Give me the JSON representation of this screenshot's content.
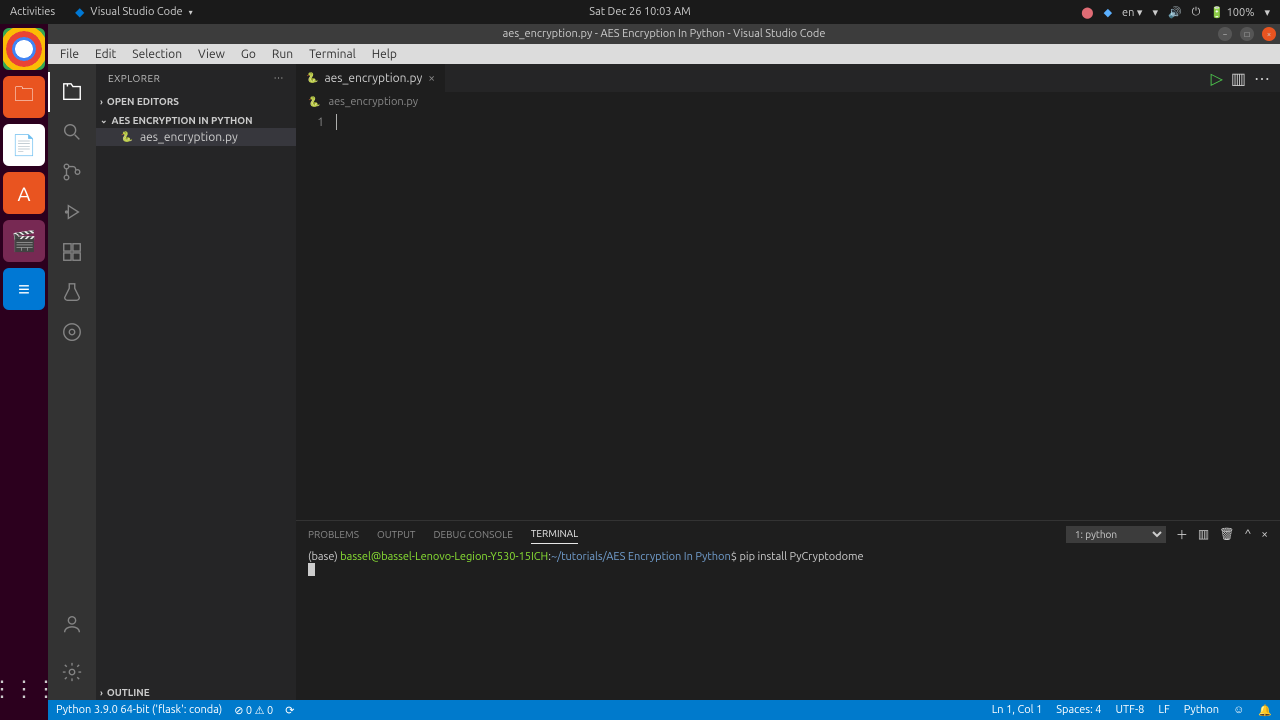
{
  "sys": {
    "activities": "Activities",
    "app_label": "Visual Studio Code",
    "datetime": "Sat Dec 26  10:03 AM",
    "lang": "en",
    "battery": "100%"
  },
  "titlebar": {
    "title": "aes_encryption.py - AES Encryption In Python - Visual Studio Code"
  },
  "menu": {
    "items": [
      "File",
      "Edit",
      "Selection",
      "View",
      "Go",
      "Run",
      "Terminal",
      "Help"
    ]
  },
  "sidebar": {
    "title": "EXPLORER",
    "open_editors": "OPEN EDITORS",
    "project": "AES ENCRYPTION IN PYTHON",
    "file": "aes_encryption.py",
    "outline": "OUTLINE"
  },
  "tabs": {
    "file": "aes_encryption.py"
  },
  "breadcrumb": {
    "file": "aes_encryption.py"
  },
  "editor": {
    "line1": "1"
  },
  "panel": {
    "tabs": {
      "problems": "PROBLEMS",
      "output": "OUTPUT",
      "debug": "DEBUG CONSOLE",
      "terminal": "TERMINAL"
    },
    "select": "1: python",
    "term_base": "(base) ",
    "term_userhost": "bassel@bassel-Lenovo-Legion-Y530-15ICH",
    "term_colon": ":",
    "term_path": "~/tutorials/AES Encryption In Python",
    "term_dollar": "$ ",
    "term_cmd": "pip install PyCryptodome"
  },
  "status": {
    "python": "Python 3.9.0 64-bit ('flask': conda)",
    "errors": "⊘ 0 ⚠ 0",
    "live": "⟳",
    "lncol": "Ln 1, Col 1",
    "spaces": "Spaces: 4",
    "encoding": "UTF-8",
    "eol": "LF",
    "lang": "Python",
    "feedback": "☺",
    "bell": "🔔"
  }
}
